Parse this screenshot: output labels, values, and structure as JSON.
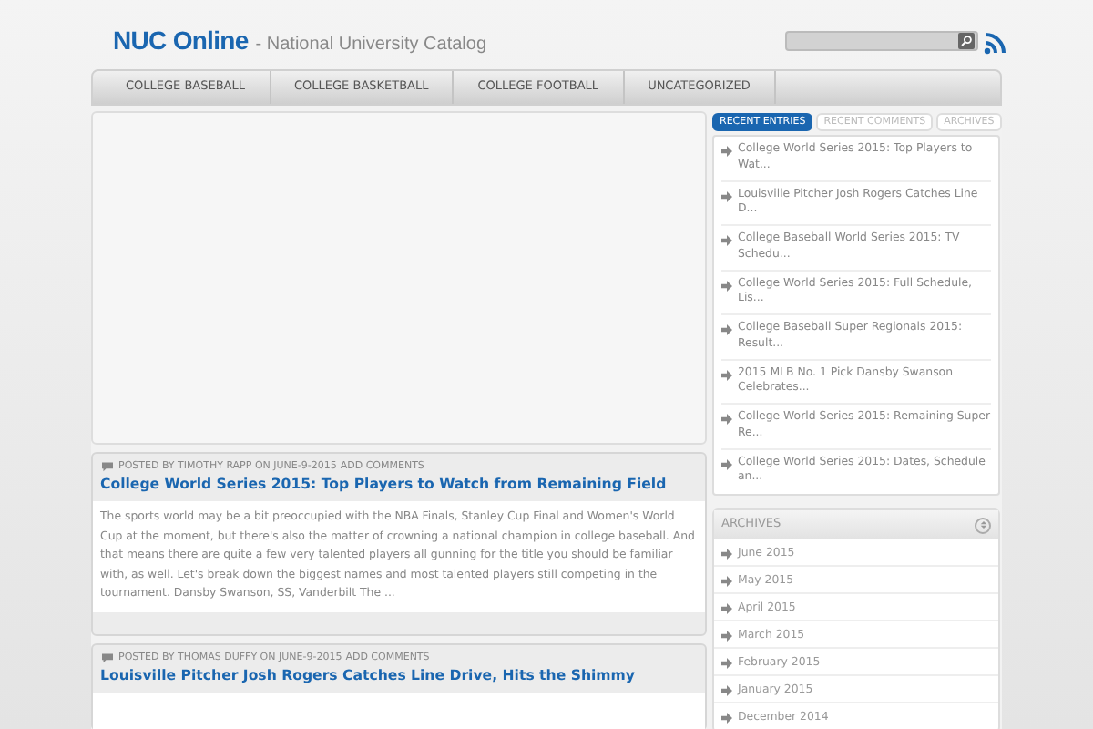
{
  "site": {
    "title": "NUC Online",
    "tagline": "- National University Catalog"
  },
  "nav": [
    "COLLEGE BASEBALL",
    "COLLEGE BASKETBALL",
    "COLLEGE FOOTBALL",
    "UNCATEGORIZED"
  ],
  "posts": [
    {
      "meta": "POSTED BY TIMOTHY RAPP ON JUNE-9-2015",
      "comments_link": "ADD COMMENTS",
      "title": "College World Series 2015: Top Players to Watch from Remaining Field",
      "excerpt": " The sports world may be a bit preoccupied with the NBA Finals, Stanley Cup Final and Women's World Cup at the moment, but there's also the matter of crowning a national champion in college baseball. And that means there are quite a few very talented players all gunning for the title you should be familiar with, as well. Let's break down the biggest names and most talented players still competing in the tournament.   Dansby Swanson, SS, Vanderbilt The ..."
    },
    {
      "meta": "POSTED BY THOMAS DUFFY ON JUNE-9-2015",
      "comments_link": "ADD COMMENTS",
      "title": "Louisville Pitcher Josh Rogers Catches Line Drive, Hits the Shimmy"
    }
  ],
  "sidebar": {
    "tabs": [
      {
        "label": "RECENT ENTRIES",
        "selected": true
      },
      {
        "label": "RECENT COMMENTS",
        "selected": false
      },
      {
        "label": "ARCHIVES",
        "selected": false
      }
    ],
    "entries": [
      "College World Series 2015: Top Players to Wat...",
      "Louisville Pitcher Josh Rogers Catches Line D...",
      "College Baseball World Series 2015: TV Schedu...",
      "College World Series 2015: Full Schedule, Lis...",
      "College Baseball Super Regionals 2015: Result...",
      "2015 MLB No. 1 Pick Dansby Swanson Celebrates...",
      "College World Series 2015: Remaining Super Re...",
      "College World Series 2015: Dates, Schedule an..."
    ],
    "archives": {
      "title": "ARCHIVES",
      "items": [
        "June 2015",
        "May 2015",
        "April 2015",
        "March 2015",
        "February 2015",
        "January 2015",
        "December 2014"
      ]
    }
  }
}
